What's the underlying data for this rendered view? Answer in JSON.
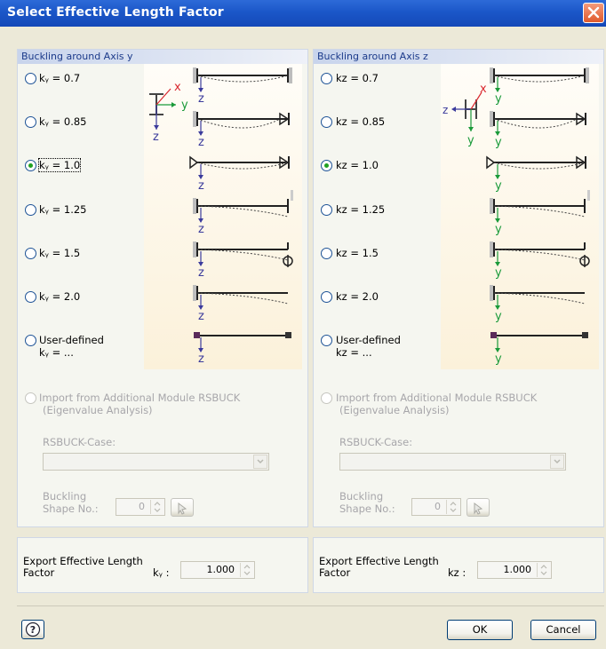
{
  "window": {
    "title": "Select Effective Length Factor"
  },
  "left": {
    "group_title": "Buckling around Axis y",
    "options": [
      {
        "label": "kᵧ = 0.7",
        "checked": false
      },
      {
        "label": "kᵧ = 0.85",
        "checked": false
      },
      {
        "label": "kᵧ = 1.0",
        "checked": true
      },
      {
        "label": "kᵧ = 1.25",
        "checked": false
      },
      {
        "label": "kᵧ = 1.5",
        "checked": false
      },
      {
        "label": "kᵧ = 2.0",
        "checked": false
      }
    ],
    "user_defined_label": "User-defined",
    "user_defined_sub": "kᵧ = ...",
    "axis_v": "z",
    "axis_main_a": "y",
    "axis_main_b": "x",
    "axis_main_c": "z",
    "import_label_1": "Import from Additional Module RSBUCK",
    "import_label_2": "(Eigenvalue Analysis)",
    "case_label": "RSBUCK-Case:",
    "shape_label_1": "Buckling",
    "shape_label_2": "Shape No.:",
    "shape_value": "0",
    "export_label_1": "Export Effective Length",
    "export_label_2": "Factor",
    "export_k_label": "kᵧ :",
    "export_value": "1.000"
  },
  "right": {
    "group_title": "Buckling around Axis z",
    "options": [
      {
        "label": "kz = 0.7",
        "checked": false
      },
      {
        "label": "kz = 0.85",
        "checked": false
      },
      {
        "label": "kz = 1.0",
        "checked": true
      },
      {
        "label": "kz = 1.25",
        "checked": false
      },
      {
        "label": "kz = 1.5",
        "checked": false
      },
      {
        "label": "kz = 2.0",
        "checked": false
      }
    ],
    "user_defined_label": "User-defined",
    "user_defined_sub": "kz = ...",
    "axis_v": "y",
    "axis_main_a": "z",
    "axis_main_b": "x",
    "axis_main_c": "y",
    "import_label_1": "Import from Additional Module RSBUCK",
    "import_label_2": "(Eigenvalue Analysis)",
    "case_label": "RSBUCK-Case:",
    "shape_label_1": "Buckling",
    "shape_label_2": "Shape No.:",
    "shape_value": "0",
    "export_label_1": "Export Effective Length",
    "export_label_2": "Factor",
    "export_k_label": "kz :",
    "export_value": "1.000"
  },
  "buttons": {
    "ok": "OK",
    "cancel": "Cancel"
  },
  "colors": {
    "axis_purple": "#3b3b9c",
    "axis_green": "#1a9a3a",
    "axis_red": "#d9282f",
    "accent_blue": "#1b57c8"
  }
}
